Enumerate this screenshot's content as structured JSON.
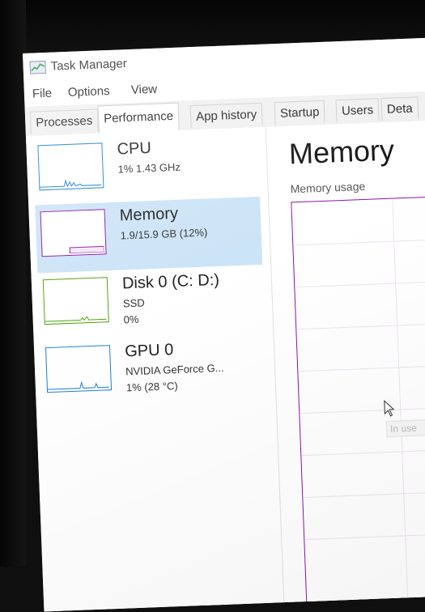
{
  "window": {
    "title": "Task Manager"
  },
  "menu": [
    "File",
    "Options",
    "View"
  ],
  "tabs": [
    "Processes",
    "Performance",
    "App history",
    "Startup",
    "Users",
    "Deta"
  ],
  "active_tab": "Performance",
  "resources": [
    {
      "name": "CPU",
      "line1": "1%  1.43 GHz",
      "line2": "",
      "accent": "#1a7fd1"
    },
    {
      "name": "Memory",
      "line1": "1.9/15.9 GB (12%)",
      "line2": "",
      "accent": "#8b12ae"
    },
    {
      "name": "Disk 0 (C: D:)",
      "line1": "SSD",
      "line2": "0%",
      "accent": "#4da60c"
    },
    {
      "name": "GPU 0",
      "line1": "NVIDIA GeForce G...",
      "line2": "1%  (28 °C)",
      "accent": "#1a7fd1"
    }
  ],
  "detail": {
    "title": "Memory",
    "usage_label": "Memory usage",
    "tooltip": "In use"
  },
  "icons": {
    "app": "task-manager-icon",
    "cursor": "mouse-pointer-icon"
  }
}
